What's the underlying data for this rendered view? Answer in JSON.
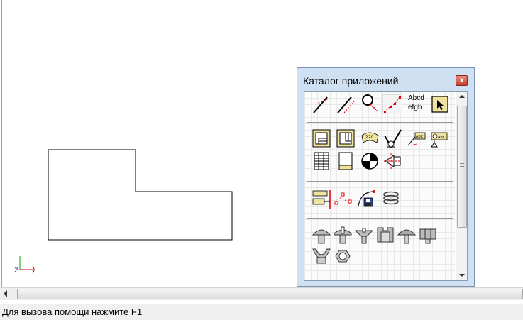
{
  "status_bar": {
    "text": "Для вызова помощи нажмите F1"
  },
  "catalog": {
    "title": "Каталог приложений",
    "close_glyph": "x",
    "text_tool": {
      "line1": "Abcd",
      "line2": "efgh"
    },
    "tools_row1": [
      "line-tool-icon",
      "parallel-line-tool-icon",
      "magnifier-tool-icon",
      "polyline-tool-icon",
      "text-tool-icon",
      "select-arrow-tool-icon"
    ],
    "tools_row2": [
      "drawing-frame-icon",
      "drawing-frame-alt-icon",
      "dimension-icon",
      "roughness-check-icon",
      "leader-text-icon",
      "datum-text-icon"
    ],
    "tools_row3": [
      "table-icon",
      "sheet-icon",
      "center-mark-icon",
      "cone-view-icon"
    ],
    "tools_row4": [
      "insert-block-icon",
      "spline-points-icon",
      "save-curve-icon",
      "spring-icon"
    ],
    "tools_row5": [
      "bolt-head-icon",
      "screw-head-icon",
      "slotted-screw-icon",
      "nut-icon",
      "dome-nut-icon",
      "hex-nut-icon"
    ],
    "tools_row6": [
      "wing-nut-icon",
      "hex-nut-top-icon"
    ]
  },
  "axis": {
    "z_label": "Z"
  },
  "colors": {
    "catalog_frame": "#cfe0f3",
    "close_button": "#c3412f",
    "canvas": "#ffffff"
  }
}
